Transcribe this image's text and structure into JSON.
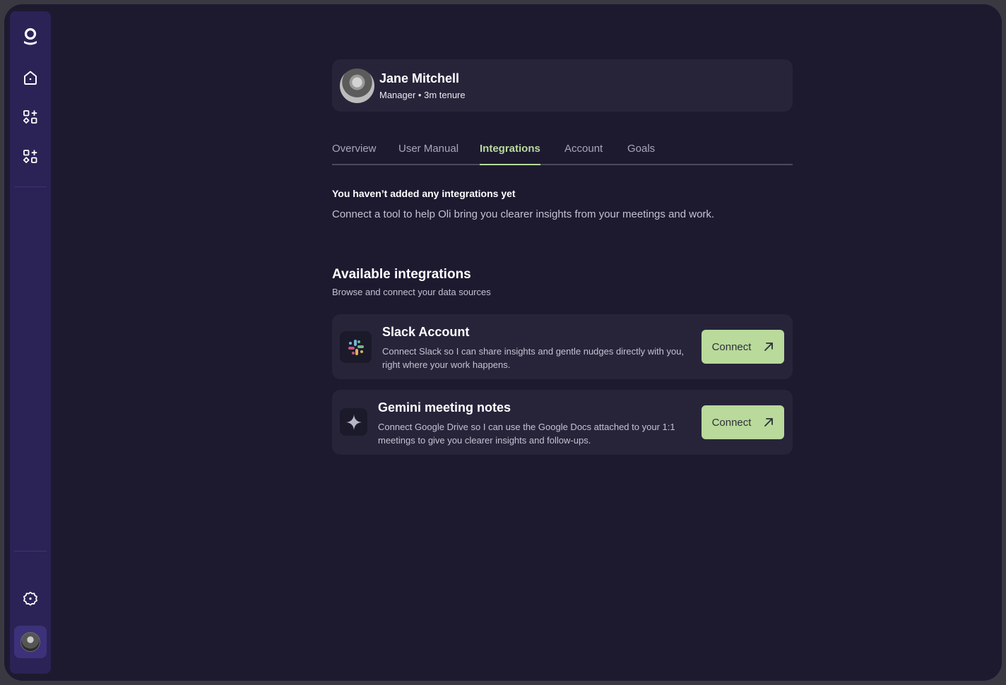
{
  "sidebar": {
    "icons": [
      "logo-icon",
      "home-icon",
      "apps-icon",
      "apps-add-icon",
      "settings-icon"
    ],
    "user_avatar": "user-avatar"
  },
  "profile": {
    "name": "Jane Mitchell",
    "meta": "Manager • 3m tenure"
  },
  "tabs": [
    {
      "label": "Overview",
      "active": false
    },
    {
      "label": "User Manual",
      "active": false
    },
    {
      "label": "Integrations",
      "active": true
    },
    {
      "label": "Account",
      "active": false
    },
    {
      "label": "Goals",
      "active": false
    }
  ],
  "empty_state": {
    "title": "You haven’t added any integrations yet",
    "description": "Connect a tool to help Oli bring you clearer insights from your meetings and work."
  },
  "available": {
    "title": "Available integrations",
    "subtitle": "Browse and connect your data sources"
  },
  "integrations": [
    {
      "icon": "slack-icon",
      "title": "Slack Account",
      "description": "Connect Slack so I can share insights and gentle nudges directly with you, right where your work happens.",
      "button_label": "Connect"
    },
    {
      "icon": "gemini-icon",
      "title": "Gemini meeting notes",
      "description": "Connect Google Drive so I can use the Google Docs attached to your 1:1 meetings to give you clearer insights and follow-ups.",
      "button_label": "Connect"
    }
  ],
  "colors": {
    "background": "#1d1a30",
    "sidebar": "#2b2356",
    "card": "#27243a",
    "accent": "#b9da9b"
  }
}
